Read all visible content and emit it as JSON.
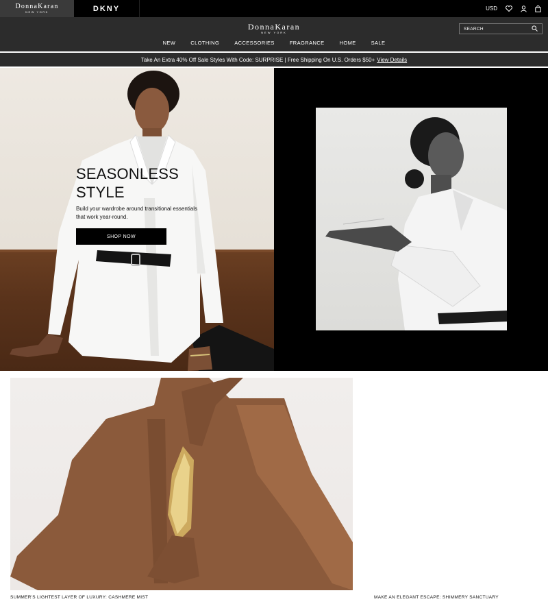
{
  "brandbar": {
    "donna_karan": "DonnaKaran",
    "donna_karan_sub": "NEW YORK",
    "dkny": "DKNY",
    "currency": "USD"
  },
  "header": {
    "logo": "DonnaKaran",
    "logo_sub": "NEW YORK",
    "search_placeholder": "SEARCH"
  },
  "nav": {
    "items": [
      {
        "label": "NEW"
      },
      {
        "label": "CLOTHING"
      },
      {
        "label": "ACCESSORIES"
      },
      {
        "label": "FRAGRANCE"
      },
      {
        "label": "HOME"
      },
      {
        "label": "SALE"
      }
    ]
  },
  "promo": {
    "text": "Take An Extra 40% Off Sale Styles With Code: SURPRISE | Free Shipping On U.S. Orders $50+",
    "link": "View Details"
  },
  "hero": {
    "title": "SEASONLESS STYLE",
    "description": "Build your wardrobe around transitional essentials that work year-round.",
    "button": "SHOP NOW"
  },
  "tiles": {
    "caption_1": "SUMMER'S LIGHTEST LAYER OF LUXURY: CASHMERE MIST",
    "caption_2": "MAKE AN ELEGANT ESCAPE: SHIMMERY SANCTUARY"
  },
  "colors": {
    "header_bg": "#2c2c2c",
    "brandbar_bg": "#000000",
    "button_bg": "#000000"
  }
}
